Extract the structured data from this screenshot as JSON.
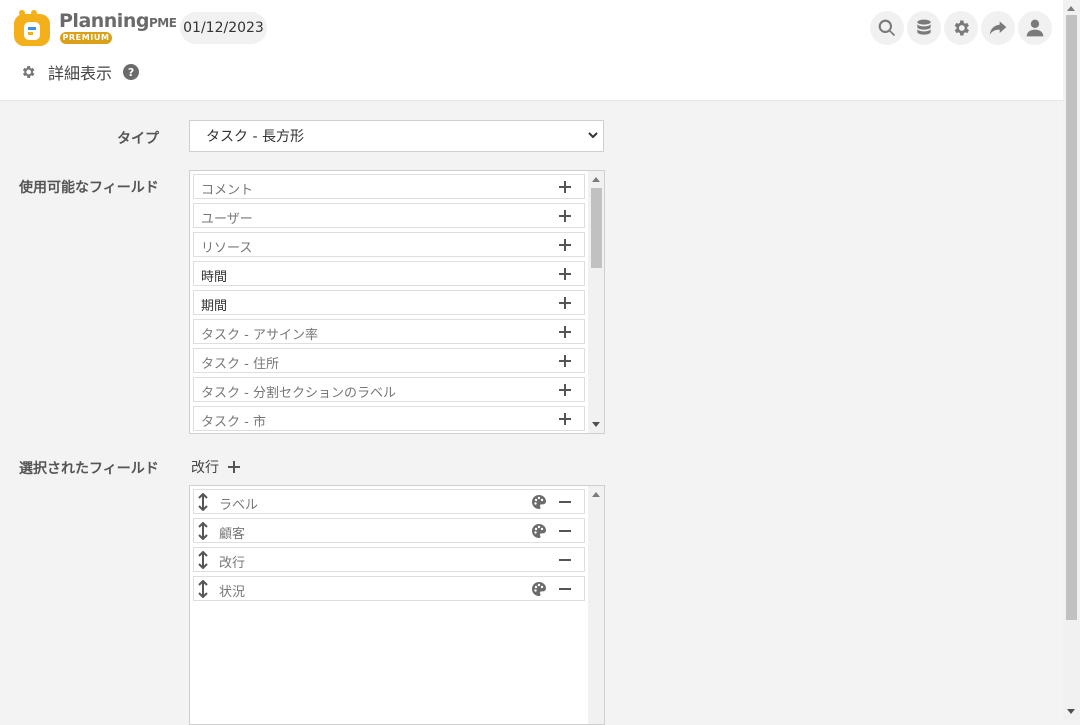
{
  "header": {
    "logo_text": "Planning",
    "logo_suffix": "PME",
    "logo_badge": "PREMIUM",
    "date": "01/12/2023",
    "buttons": [
      "search-icon",
      "database-icon",
      "gear-icon",
      "share-icon",
      "user-icon"
    ]
  },
  "subheader": {
    "title": "詳細表示"
  },
  "form": {
    "type_label": "タイプ",
    "type_value": "タスク - 長方形",
    "available_label": "使用可能なフィールド",
    "available_fields": [
      "コメント",
      "ユーザー",
      "リソース",
      "時間",
      "期間",
      "タスク - アサイン率",
      "タスク - 住所",
      "タスク - 分割セクションのラベル",
      "タスク - 市"
    ],
    "selected_label": "選択されたフィールド",
    "newline_label": "改行",
    "selected_fields": [
      "ラベル",
      "顧客",
      "改行",
      "状況"
    ]
  },
  "colors": {
    "accent": "#d9a018",
    "icon": "#6b7280"
  }
}
